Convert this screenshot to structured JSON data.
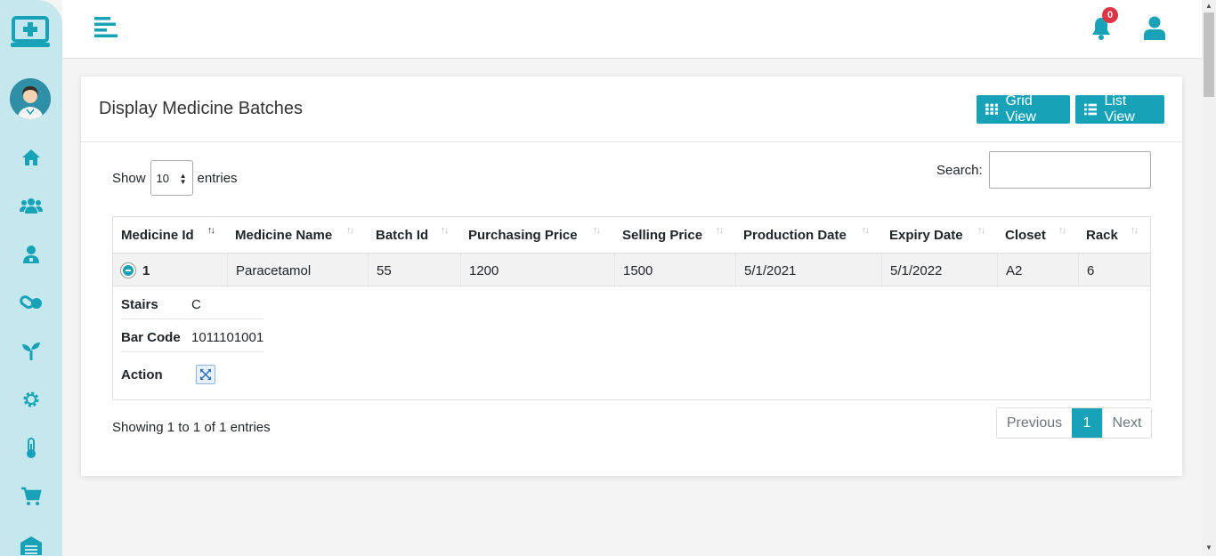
{
  "colors": {
    "accent": "#17a2b8",
    "sidebar_bg": "#c5e8ee",
    "badge": "#dc3545"
  },
  "topbar": {
    "notification_count": "0"
  },
  "sidebar": {
    "icons": [
      "home-icon",
      "users-icon",
      "user-doctor-icon",
      "pills-icon",
      "seedling-icon",
      "gear-icon",
      "thermometer-icon",
      "cart-icon",
      "warehouse-icon"
    ]
  },
  "card": {
    "title": "Display Medicine Batches",
    "grid_view_label": "Grid View",
    "list_view_label": "List View"
  },
  "controls": {
    "show_label": "Show",
    "entries_value": "10",
    "entries_label": "entries",
    "search_label": "Search:"
  },
  "table": {
    "headers": [
      "Medicine Id",
      "Medicine Name",
      "Batch Id",
      "Purchasing Price",
      "Selling Price",
      "Production Date",
      "Expiry Date",
      "Closet",
      "Rack"
    ],
    "rows": [
      [
        "1",
        "Paracetamol",
        "55",
        "1200",
        "1500",
        "5/1/2021",
        "5/1/2022",
        "A2",
        "6"
      ]
    ],
    "detail": {
      "stairs_label": "Stairs",
      "stairs_value": "C",
      "barcode_label": "Bar Code",
      "barcode_value": "1011101001",
      "action_label": "Action"
    }
  },
  "footer": {
    "info": "Showing 1 to 1 of 1 entries",
    "prev": "Previous",
    "page": "1",
    "next": "Next"
  }
}
